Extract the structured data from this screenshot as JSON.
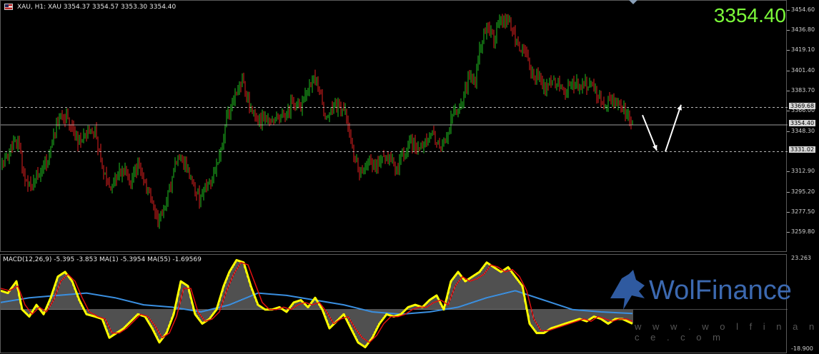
{
  "header": {
    "symbol_line": "XAU, H1: XAU  3354.37 3354.57 3353.30 3354.40",
    "macd_line": "MACD(12,26,9) -5.395 -3.853 MA(1) -5.3954 MA(55) -1.69569",
    "big_price": "3354.40"
  },
  "logo": {
    "text": "WolFinance",
    "url": "w w w . w o l f i n a n c e . c o m"
  },
  "colors": {
    "bull": "#1fbf1f",
    "bear": "#e02020",
    "macd_yellow": "#ffff00",
    "signal_red": "#e01010",
    "ma55_blue": "#3a8fe0",
    "current_price": "#7cfc3a"
  },
  "chart_data": [
    {
      "type": "candlestick",
      "title": "XAU, H1",
      "ylim": [
        3242.6,
        3463.1
      ],
      "y_ticks": [
        "3454.60",
        "3436.80",
        "3419.10",
        "3401.40",
        "3383.70",
        "3366.00",
        "3348.30",
        "3312.90",
        "3295.20",
        "3277.50",
        "3259.80"
      ],
      "levels": [
        {
          "value": 3369.68,
          "label": "3369.68",
          "style": "dashed"
        },
        {
          "value": 3354.4,
          "label": "3354.40",
          "style": "solid"
        },
        {
          "value": 3331.02,
          "label": "3331.02",
          "style": "dashed"
        }
      ],
      "close_path": [
        [
          0,
          3318
        ],
        [
          14,
          3333
        ],
        [
          24,
          3340
        ],
        [
          34,
          3305
        ],
        [
          44,
          3300
        ],
        [
          54,
          3314
        ],
        [
          64,
          3320
        ],
        [
          72,
          3340
        ],
        [
          82,
          3362
        ],
        [
          92,
          3360
        ],
        [
          102,
          3350
        ],
        [
          110,
          3338
        ],
        [
          120,
          3345
        ],
        [
          132,
          3350
        ],
        [
          142,
          3320
        ],
        [
          152,
          3300
        ],
        [
          162,
          3310
        ],
        [
          172,
          3315
        ],
        [
          182,
          3305
        ],
        [
          192,
          3320
        ],
        [
          202,
          3300
        ],
        [
          212,
          3290
        ],
        [
          220,
          3265
        ],
        [
          230,
          3285
        ],
        [
          240,
          3305
        ],
        [
          248,
          3330
        ],
        [
          258,
          3320
        ],
        [
          268,
          3305
        ],
        [
          278,
          3290
        ],
        [
          288,
          3300
        ],
        [
          298,
          3310
        ],
        [
          308,
          3330
        ],
        [
          318,
          3365
        ],
        [
          328,
          3380
        ],
        [
          338,
          3395
        ],
        [
          348,
          3370
        ],
        [
          358,
          3360
        ],
        [
          368,
          3358
        ],
        [
          378,
          3355
        ],
        [
          388,
          3362
        ],
        [
          398,
          3360
        ],
        [
          408,
          3375
        ],
        [
          418,
          3370
        ],
        [
          428,
          3380
        ],
        [
          438,
          3395
        ],
        [
          446,
          3385
        ],
        [
          454,
          3360
        ],
        [
          464,
          3370
        ],
        [
          474,
          3372
        ],
        [
          484,
          3362
        ],
        [
          494,
          3330
        ],
        [
          504,
          3310
        ],
        [
          514,
          3320
        ],
        [
          524,
          3318
        ],
        [
          534,
          3328
        ],
        [
          544,
          3325
        ],
        [
          554,
          3315
        ],
        [
          564,
          3330
        ],
        [
          574,
          3340
        ],
        [
          584,
          3332
        ],
        [
          594,
          3340
        ],
        [
          604,
          3345
        ],
        [
          614,
          3335
        ],
        [
          624,
          3340
        ],
        [
          634,
          3370
        ],
        [
          644,
          3370
        ],
        [
          654,
          3395
        ],
        [
          664,
          3395
        ],
        [
          672,
          3425
        ],
        [
          680,
          3440
        ],
        [
          690,
          3430
        ],
        [
          700,
          3445
        ],
        [
          712,
          3445
        ],
        [
          722,
          3425
        ],
        [
          732,
          3420
        ],
        [
          742,
          3400
        ],
        [
          752,
          3395
        ],
        [
          762,
          3385
        ],
        [
          772,
          3395
        ],
        [
          782,
          3390
        ],
        [
          792,
          3385
        ],
        [
          802,
          3392
        ],
        [
          812,
          3388
        ],
        [
          822,
          3390
        ],
        [
          832,
          3385
        ],
        [
          842,
          3370
        ],
        [
          852,
          3378
        ],
        [
          862,
          3372
        ],
        [
          872,
          3368
        ],
        [
          884,
          3354
        ]
      ],
      "annotations": [
        {
          "type": "arrow",
          "direction": "down",
          "from": [
            898,
            3363
          ],
          "to": [
            918,
            3332
          ]
        },
        {
          "type": "arrow",
          "direction": "up",
          "from": [
            930,
            3331
          ],
          "to": [
            952,
            3372
          ]
        }
      ]
    },
    {
      "type": "macd",
      "title": "MACD(12,26,9)",
      "ylim": [
        -18.9,
        23.263
      ],
      "y_ticks": [
        "23.263",
        "-18.900"
      ],
      "histogram_sample_step": 2,
      "macd_path": [
        [
          0,
          8
        ],
        [
          10,
          7
        ],
        [
          22,
          12
        ],
        [
          30,
          0
        ],
        [
          40,
          -3
        ],
        [
          50,
          2
        ],
        [
          60,
          -2
        ],
        [
          70,
          5
        ],
        [
          80,
          14
        ],
        [
          90,
          16
        ],
        [
          100,
          12
        ],
        [
          110,
          4
        ],
        [
          120,
          -2
        ],
        [
          132,
          -3
        ],
        [
          142,
          -4
        ],
        [
          152,
          -12
        ],
        [
          162,
          -10
        ],
        [
          172,
          -8
        ],
        [
          182,
          -5
        ],
        [
          192,
          -2
        ],
        [
          202,
          -3
        ],
        [
          212,
          -8
        ],
        [
          222,
          -14
        ],
        [
          232,
          -10
        ],
        [
          242,
          -2
        ],
        [
          252,
          12
        ],
        [
          262,
          10
        ],
        [
          272,
          -2
        ],
        [
          282,
          -6
        ],
        [
          292,
          -4
        ],
        [
          302,
          0
        ],
        [
          312,
          10
        ],
        [
          320,
          16
        ],
        [
          330,
          21
        ],
        [
          340,
          20
        ],
        [
          350,
          10
        ],
        [
          360,
          2
        ],
        [
          370,
          0
        ],
        [
          380,
          0
        ],
        [
          390,
          1
        ],
        [
          400,
          -1
        ],
        [
          410,
          3
        ],
        [
          420,
          4
        ],
        [
          430,
          1
        ],
        [
          440,
          5
        ],
        [
          450,
          0
        ],
        [
          460,
          -8
        ],
        [
          470,
          -5
        ],
        [
          480,
          -2
        ],
        [
          490,
          -8
        ],
        [
          500,
          -14
        ],
        [
          510,
          -16
        ],
        [
          520,
          -12
        ],
        [
          530,
          -6
        ],
        [
          540,
          -2
        ],
        [
          550,
          -3
        ],
        [
          560,
          -2
        ],
        [
          570,
          1
        ],
        [
          580,
          2
        ],
        [
          590,
          1
        ],
        [
          600,
          4
        ],
        [
          610,
          6
        ],
        [
          620,
          0
        ],
        [
          630,
          12
        ],
        [
          640,
          16
        ],
        [
          650,
          12
        ],
        [
          660,
          14
        ],
        [
          670,
          16
        ],
        [
          680,
          20
        ],
        [
          690,
          18
        ],
        [
          700,
          16
        ],
        [
          710,
          18
        ],
        [
          720,
          14
        ],
        [
          730,
          10
        ],
        [
          740,
          -6
        ],
        [
          750,
          -10
        ],
        [
          760,
          -10
        ],
        [
          770,
          -8
        ],
        [
          780,
          -7
        ],
        [
          790,
          -6
        ],
        [
          800,
          -5
        ],
        [
          810,
          -4
        ],
        [
          820,
          -5
        ],
        [
          830,
          -3
        ],
        [
          840,
          -4
        ],
        [
          850,
          -6
        ],
        [
          860,
          -4
        ],
        [
          870,
          -4
        ],
        [
          884,
          -6
        ]
      ],
      "signal_path": [
        [
          0,
          9
        ],
        [
          12,
          8
        ],
        [
          24,
          10
        ],
        [
          34,
          2
        ],
        [
          44,
          -2
        ],
        [
          54,
          1
        ],
        [
          64,
          -1
        ],
        [
          74,
          4
        ],
        [
          84,
          12
        ],
        [
          94,
          15
        ],
        [
          104,
          12
        ],
        [
          114,
          5
        ],
        [
          124,
          -1
        ],
        [
          136,
          -3
        ],
        [
          146,
          -4
        ],
        [
          156,
          -10
        ],
        [
          166,
          -10
        ],
        [
          176,
          -8
        ],
        [
          186,
          -5
        ],
        [
          196,
          -2
        ],
        [
          206,
          -3
        ],
        [
          216,
          -7
        ],
        [
          226,
          -12
        ],
        [
          236,
          -10
        ],
        [
          246,
          -3
        ],
        [
          256,
          9
        ],
        [
          266,
          9
        ],
        [
          276,
          -1
        ],
        [
          286,
          -5
        ],
        [
          296,
          -4
        ],
        [
          306,
          -1
        ],
        [
          316,
          8
        ],
        [
          326,
          15
        ],
        [
          336,
          20
        ],
        [
          346,
          19
        ],
        [
          356,
          11
        ],
        [
          366,
          3
        ],
        [
          376,
          0
        ],
        [
          386,
          0
        ],
        [
          396,
          1
        ],
        [
          406,
          0
        ],
        [
          416,
          2
        ],
        [
          426,
          3
        ],
        [
          436,
          2
        ],
        [
          446,
          3
        ],
        [
          456,
          -1
        ],
        [
          466,
          -6
        ],
        [
          476,
          -4
        ],
        [
          486,
          -3
        ],
        [
          496,
          -8
        ],
        [
          506,
          -12
        ],
        [
          516,
          -14
        ],
        [
          526,
          -11
        ],
        [
          536,
          -6
        ],
        [
          546,
          -3
        ],
        [
          556,
          -3
        ],
        [
          566,
          -2
        ],
        [
          576,
          0
        ],
        [
          586,
          1
        ],
        [
          596,
          1
        ],
        [
          606,
          3
        ],
        [
          616,
          4
        ],
        [
          626,
          2
        ],
        [
          636,
          10
        ],
        [
          646,
          14
        ],
        [
          656,
          12
        ],
        [
          666,
          13
        ],
        [
          676,
          15
        ],
        [
          686,
          19
        ],
        [
          696,
          18
        ],
        [
          706,
          16
        ],
        [
          716,
          17
        ],
        [
          726,
          14
        ],
        [
          736,
          8
        ],
        [
          746,
          -4
        ],
        [
          756,
          -9
        ],
        [
          766,
          -9
        ],
        [
          776,
          -8
        ],
        [
          786,
          -7
        ],
        [
          796,
          -6
        ],
        [
          806,
          -5
        ],
        [
          816,
          -4
        ],
        [
          826,
          -5
        ],
        [
          836,
          -3
        ],
        [
          846,
          -4
        ],
        [
          856,
          -5
        ],
        [
          866,
          -4
        ],
        [
          876,
          -4
        ],
        [
          884,
          -5
        ]
      ],
      "ma55_path": [
        [
          0,
          3
        ],
        [
          40,
          5
        ],
        [
          80,
          6
        ],
        [
          120,
          7
        ],
        [
          160,
          5
        ],
        [
          200,
          2
        ],
        [
          240,
          1
        ],
        [
          280,
          -1
        ],
        [
          320,
          2
        ],
        [
          360,
          7
        ],
        [
          400,
          6
        ],
        [
          440,
          4
        ],
        [
          480,
          2
        ],
        [
          520,
          -1
        ],
        [
          560,
          -2
        ],
        [
          600,
          -1
        ],
        [
          640,
          1
        ],
        [
          680,
          5
        ],
        [
          720,
          8
        ],
        [
          760,
          4
        ],
        [
          800,
          0
        ],
        [
          840,
          -1
        ],
        [
          884,
          -1.7
        ]
      ]
    }
  ]
}
